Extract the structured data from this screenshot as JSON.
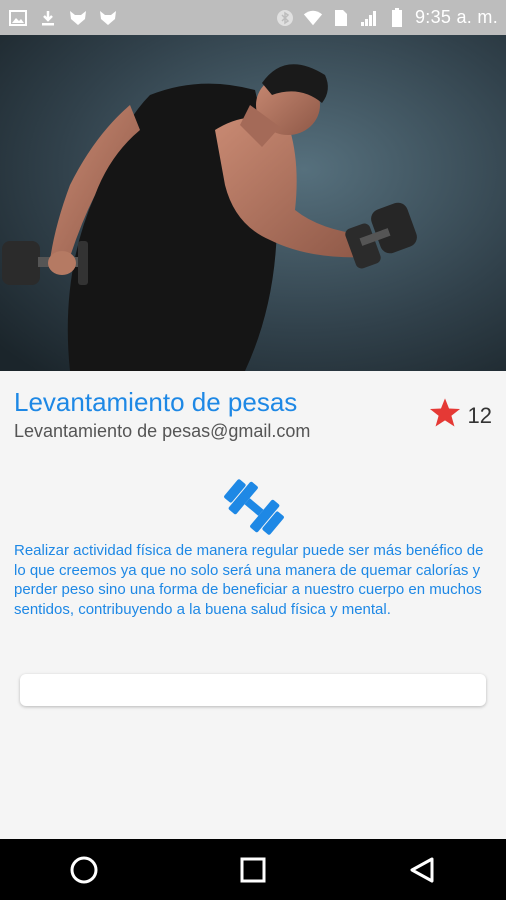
{
  "status_bar": {
    "time": "9:35 a. m.",
    "left_icons": [
      "image-icon",
      "download-icon",
      "fox-icon",
      "fox-icon"
    ],
    "right_icons": [
      "bluetooth-icon",
      "wifi-icon",
      "sim-icon",
      "signal-icon",
      "battery-icon"
    ]
  },
  "hero": {
    "image": "man lifting dumbbells"
  },
  "profile": {
    "title": "Levantamiento de pesas",
    "email": "Levantamiento de pesas@gmail.com",
    "rating_count": "12"
  },
  "description": "Realizar actividad física de manera regular puede ser más benéfico de lo que creemos ya que no solo será una manera de quemar calorías y perder peso sino una forma de beneficiar a nuestro cuerpo en muchos sentidos, contribuyendo a la buena salud física y mental.",
  "colors": {
    "accent": "#1e88e5",
    "star": "#e53935",
    "status_bar": "#bdbdbd",
    "nav_bar": "#000000"
  },
  "nav": [
    "home-button",
    "recents-button",
    "back-button"
  ]
}
